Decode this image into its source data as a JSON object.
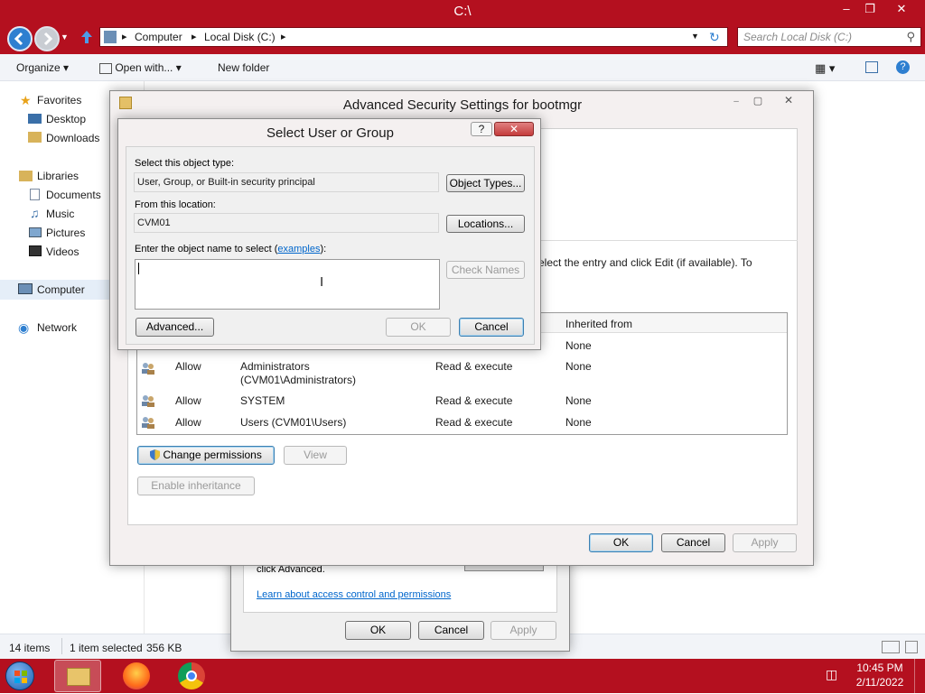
{
  "explorer": {
    "title": "C:\\",
    "address": {
      "segments": [
        "Computer",
        "Local Disk (C:)"
      ]
    },
    "search_placeholder": "Search Local Disk (C:)",
    "toolbar": {
      "organize": "Organize",
      "open_with": "Open with...",
      "new_folder": "New folder"
    },
    "nav": {
      "favorites": "Favorites",
      "favorites_items": [
        "Desktop",
        "Downloads"
      ],
      "libraries": "Libraries",
      "libraries_items": [
        "Documents",
        "Music",
        "Pictures",
        "Videos"
      ],
      "computer": "Computer",
      "network": "Network"
    },
    "status": {
      "items": "14 items",
      "selected": "1 item selected",
      "size": "356 KB"
    }
  },
  "properties_dialog": {
    "advanced_text": "click Advanced.",
    "link": "Learn about access control and permissions",
    "ok": "OK",
    "cancel": "Cancel",
    "apply": "Apply"
  },
  "advanced_dialog": {
    "title": "Advanced Security Settings for bootmgr",
    "hint": "elect the entry and click Edit (if available). To",
    "columns": {
      "inherited": "Inherited from"
    },
    "entries": [
      {
        "type": "",
        "principal": "",
        "principal2": "",
        "access": "",
        "inherited": "None"
      },
      {
        "type": "Allow",
        "principal": "Administrators",
        "principal2": "(CVM01\\Administrators)",
        "access": "Read & execute",
        "inherited": "None"
      },
      {
        "type": "Allow",
        "principal": "SYSTEM",
        "principal2": "",
        "access": "Read & execute",
        "inherited": "None"
      },
      {
        "type": "Allow",
        "principal": "Users (CVM01\\Users)",
        "principal2": "",
        "access": "Read & execute",
        "inherited": "None"
      }
    ],
    "change_permissions": "Change permissions",
    "view": "View",
    "enable_inheritance": "Enable inheritance",
    "ok": "OK",
    "cancel": "Cancel",
    "apply": "Apply"
  },
  "select_dialog": {
    "title": "Select User or Group",
    "object_type_label": "Select this object type:",
    "object_type_value": "User, Group, or Built-in security principal",
    "object_types_button": "Object Types...",
    "location_label": "From this location:",
    "location_value": "CVM01",
    "locations_button": "Locations...",
    "name_label_pre": "Enter the object name to select (",
    "name_label_link": "examples",
    "name_label_post": "):",
    "name_value": "",
    "check_names_button": "Check Names",
    "advanced_button": "Advanced...",
    "ok_button": "OK",
    "cancel_button": "Cancel",
    "help_button": "?"
  },
  "taskbar": {
    "time": "10:45 PM",
    "date": "2/11/2022"
  },
  "colors": {
    "accent": "#b4101f",
    "link": "#0066cc"
  }
}
